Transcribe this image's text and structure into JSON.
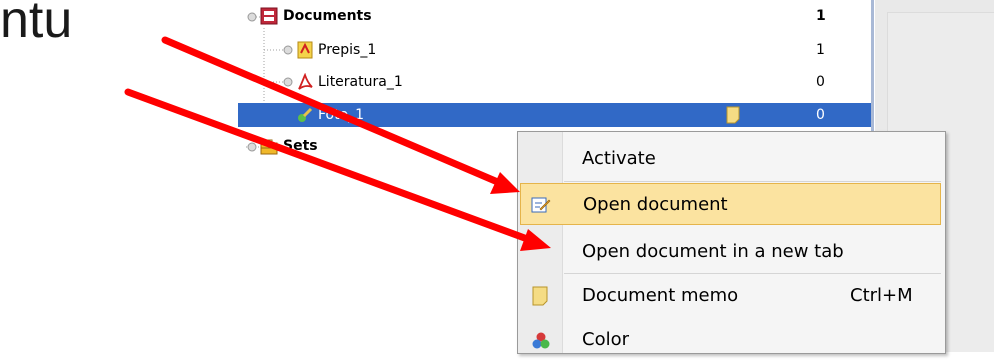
{
  "slide": {
    "text": "ntu"
  },
  "tree": {
    "rows": [
      {
        "label": "Documents",
        "count": "1"
      },
      {
        "label": "Prepis_1",
        "count": "1"
      },
      {
        "label": "Literatura_1",
        "count": "0"
      },
      {
        "label": "Foto_1",
        "count": "0"
      },
      {
        "label": "Sets",
        "count": ""
      }
    ]
  },
  "context_menu": {
    "items": [
      {
        "label": "Activate",
        "shortcut": ""
      },
      {
        "label": "Open document",
        "shortcut": ""
      },
      {
        "label": "Open document in a new tab",
        "shortcut": ""
      },
      {
        "label": "Document memo",
        "shortcut": "Ctrl+M"
      },
      {
        "label": "Color",
        "shortcut": ""
      }
    ],
    "highlighted": "Open document"
  },
  "colors": {
    "selection": "#3169c6",
    "highlight": "#fbe3a0",
    "arrow": "#ff0000"
  },
  "icons": [
    "documents-folder-icon",
    "transcript-icon",
    "pdf-icon",
    "photo-icon",
    "memo-icon",
    "sets-briefcase-icon",
    "edit-icon",
    "color-icon"
  ]
}
